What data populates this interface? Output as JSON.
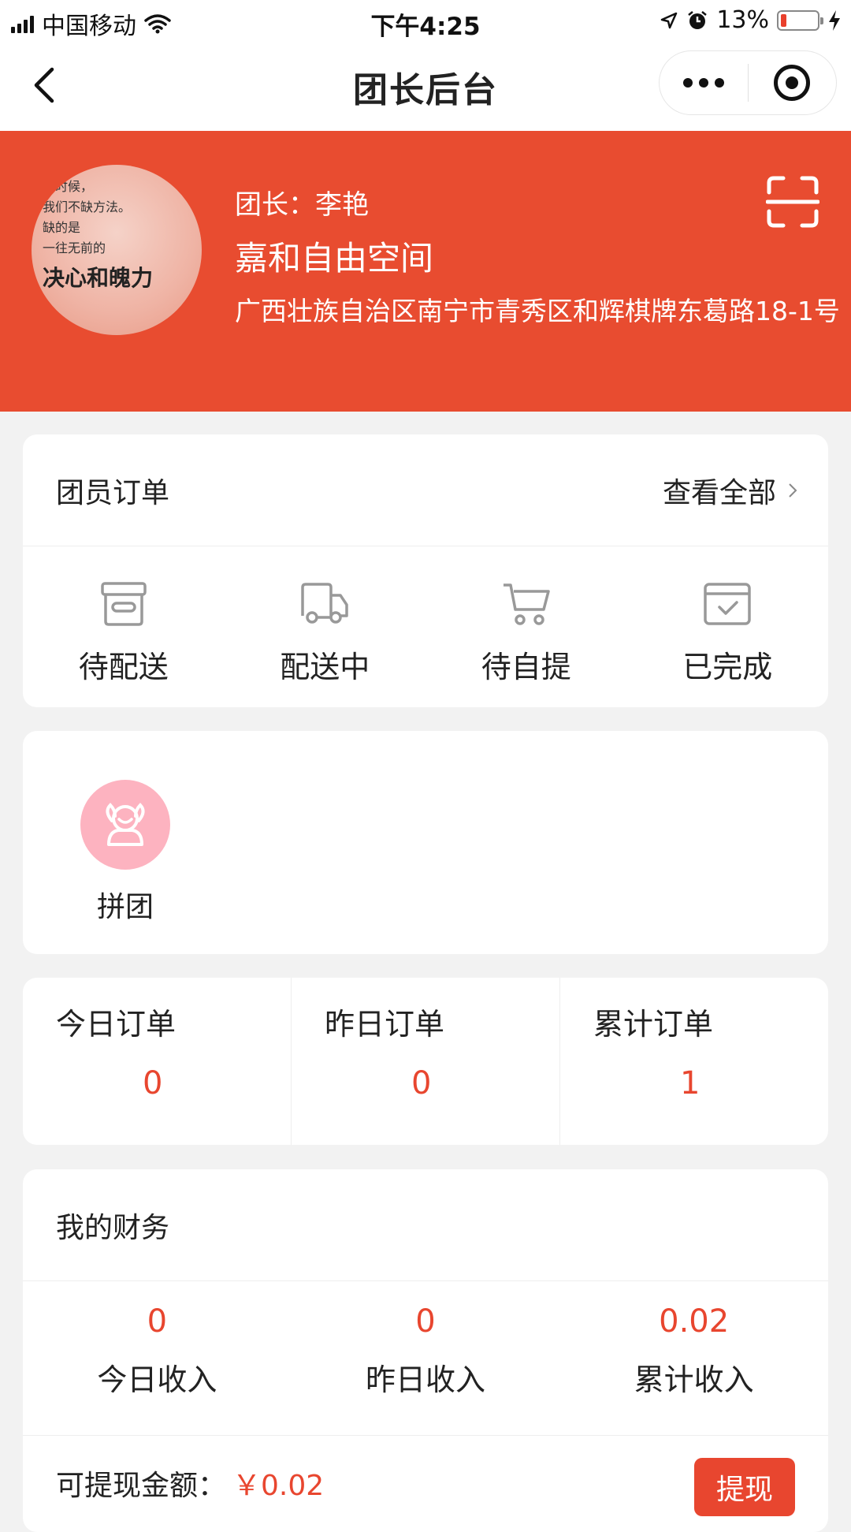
{
  "status_bar": {
    "carrier": "中国移动",
    "time": "下午4:25",
    "battery_percent": "13%"
  },
  "nav": {
    "title": "团长后台"
  },
  "header": {
    "leader_label": "团长：李艳",
    "store_name": "嘉和自由空间",
    "address": "广西壮族自治区南宁市青秀区和辉棋牌东葛路18-1号",
    "avatar_text": [
      "多时候，",
      "我们不缺方法。",
      "缺的是",
      "一往无前的",
      "决心和魄力"
    ]
  },
  "orders": {
    "title": "团员订单",
    "view_all": "查看全部",
    "items": [
      {
        "label": "待配送",
        "icon": "archive-box-icon"
      },
      {
        "label": "配送中",
        "icon": "truck-icon"
      },
      {
        "label": "待自提",
        "icon": "cart-icon"
      },
      {
        "label": "已完成",
        "icon": "check-box-icon"
      }
    ]
  },
  "group_buy": {
    "label": "拼团",
    "icon": "group-buy-icon",
    "icon_color": "#fdb3c0"
  },
  "stats": [
    {
      "label": "今日订单",
      "value": "0"
    },
    {
      "label": "昨日订单",
      "value": "0"
    },
    {
      "label": "累计订单",
      "value": "1"
    }
  ],
  "finance": {
    "title": "我的财务",
    "income": [
      {
        "value": "0",
        "label": "今日收入"
      },
      {
        "value": "0",
        "label": "昨日收入"
      },
      {
        "value": "0.02",
        "label": "累计收入"
      }
    ],
    "withdrawable_label": "可提现金额：",
    "withdrawable_amount": "￥0.02",
    "withdraw_button": "提现"
  },
  "colors": {
    "brand": "#e84c30",
    "accent_text": "#e8462f",
    "background": "#f2f2f2"
  }
}
